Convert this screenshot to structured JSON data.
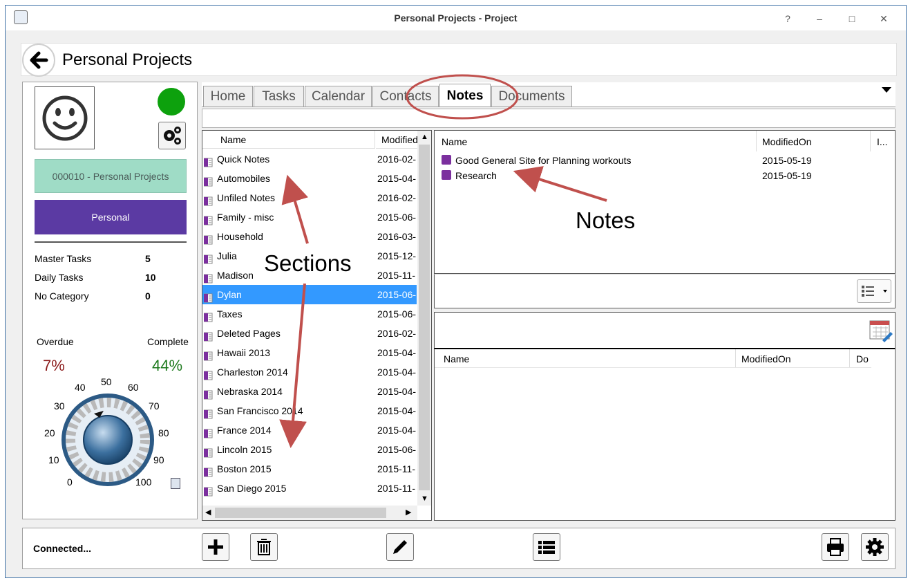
{
  "window": {
    "title": "Personal Projects - Project",
    "help": "?",
    "minimize": "–",
    "restore": "□",
    "close": "✕"
  },
  "header": {
    "title": "Personal Projects"
  },
  "project": {
    "id_label": "000010 - Personal Projects",
    "category": "Personal"
  },
  "stats": [
    {
      "label": "Master Tasks",
      "value": "5"
    },
    {
      "label": "Daily Tasks",
      "value": "10"
    },
    {
      "label": "No Category",
      "value": "0"
    }
  ],
  "progress": {
    "overdue_label": "Overdue",
    "overdue_value": "7%",
    "complete_label": "Complete",
    "complete_value": "44%",
    "dial_percent": 44
  },
  "dial": {
    "labels": [
      "0",
      "10",
      "20",
      "30",
      "40",
      "50",
      "60",
      "70",
      "80",
      "90",
      "100"
    ]
  },
  "tabs": [
    "Home",
    "Tasks",
    "Calendar",
    "Contacts",
    "Notes",
    "Documents"
  ],
  "active_tab": "Notes",
  "sections": {
    "col_name": "Name",
    "col_modified": "Modified",
    "rows": [
      {
        "name": "Quick Notes",
        "modified": "2016-02-"
      },
      {
        "name": "Automobiles",
        "modified": "2015-04-"
      },
      {
        "name": "Unfiled Notes",
        "modified": "2016-02-"
      },
      {
        "name": "Family - misc",
        "modified": "2015-06-"
      },
      {
        "name": "Household",
        "modified": "2016-03-"
      },
      {
        "name": "Julia",
        "modified": "2015-12-"
      },
      {
        "name": "Madison",
        "modified": "2015-11-"
      },
      {
        "name": "Dylan",
        "modified": "2015-06-"
      },
      {
        "name": "Taxes",
        "modified": "2015-06-"
      },
      {
        "name": "Deleted Pages",
        "modified": "2016-02-"
      },
      {
        "name": "Hawaii 2013",
        "modified": "2015-04-"
      },
      {
        "name": "Charleston 2014",
        "modified": "2015-04-"
      },
      {
        "name": "Nebraska 2014",
        "modified": "2015-04-"
      },
      {
        "name": "San Francisco 2014",
        "modified": "2015-04-"
      },
      {
        "name": "France 2014",
        "modified": "2015-04-"
      },
      {
        "name": "Lincoln 2015",
        "modified": "2015-06-"
      },
      {
        "name": "Boston 2015",
        "modified": "2015-11-"
      },
      {
        "name": "San Diego 2015",
        "modified": "2015-11-"
      }
    ],
    "selected": "Dylan"
  },
  "notes": {
    "col_name": "Name",
    "col_modified": "ModifiedOn",
    "col_extra": "I...",
    "rows": [
      {
        "name": "Good General Site for Planning workouts",
        "modified": "2015-05-19"
      },
      {
        "name": "Research",
        "modified": "2015-05-19"
      }
    ]
  },
  "documents": {
    "col_name": "Name",
    "col_modified": "ModifiedOn",
    "col_extra": "Do"
  },
  "footer": {
    "status": "Connected..."
  },
  "annotations": {
    "sections": "Sections",
    "notes": "Notes"
  },
  "colors": {
    "accent_purple": "#5b3aa3",
    "status_green": "#0da10d",
    "id_bg": "#9fdcc6",
    "selection": "#3399ff",
    "annotation_red": "#c0504d"
  }
}
